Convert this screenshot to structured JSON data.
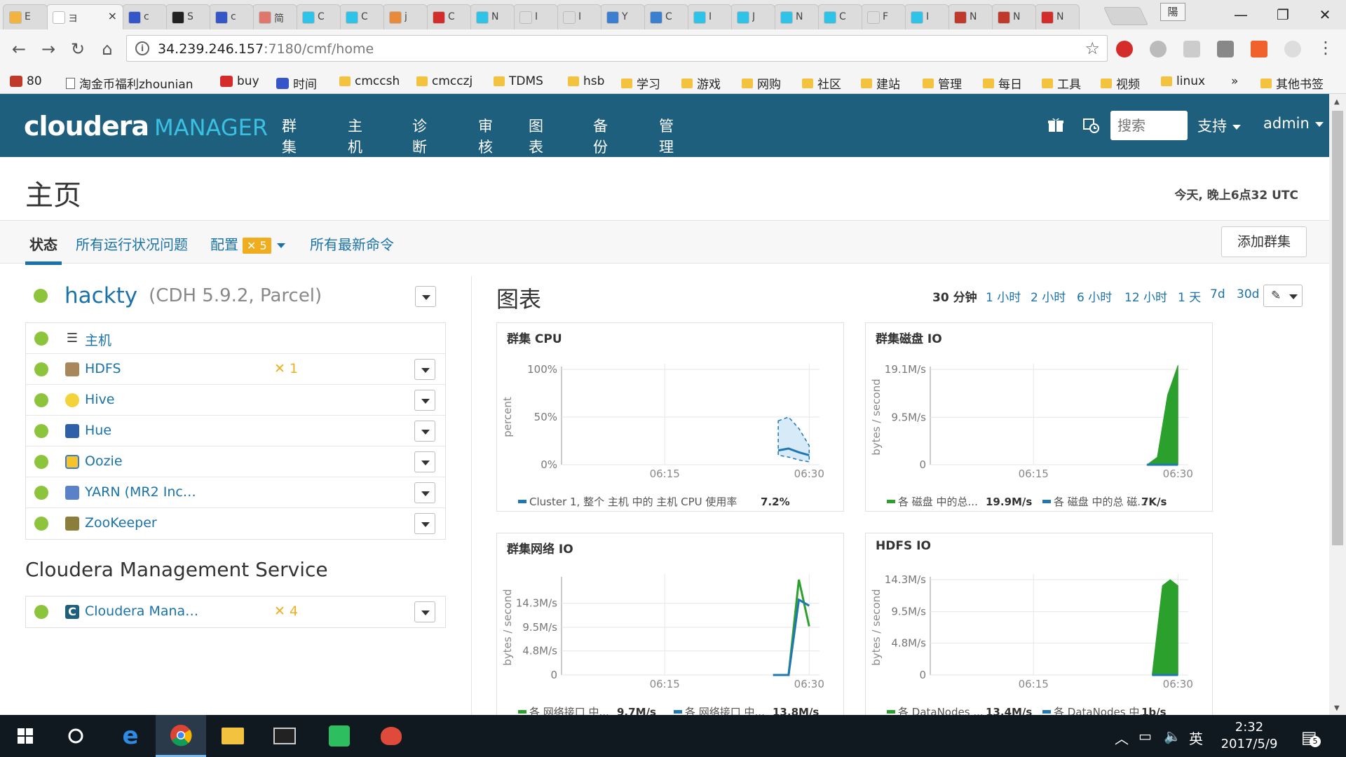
{
  "browser": {
    "tabs": [
      {
        "title": "E",
        "color": "#f3b33d"
      },
      {
        "title": "ヨ",
        "color": "#ffffff",
        "active": true
      },
      {
        "title": "c",
        "color": "#3556c9"
      },
      {
        "title": "S",
        "color": "#222222"
      },
      {
        "title": "c",
        "color": "#3556c9"
      },
      {
        "title": "简",
        "color": "#e0776b"
      },
      {
        "title": "C",
        "color": "#2ec3e8"
      },
      {
        "title": "C",
        "color": "#2ec3e8"
      },
      {
        "title": "j",
        "color": "#e98a3a"
      },
      {
        "title": "C",
        "color": "#d42b2b"
      },
      {
        "title": "N",
        "color": "#2ec3e8"
      },
      {
        "title": "I",
        "color": "#dddddd"
      },
      {
        "title": "I",
        "color": "#dddddd"
      },
      {
        "title": "Y",
        "color": "#3b7fd0"
      },
      {
        "title": "C",
        "color": "#3b7fd0"
      },
      {
        "title": "I",
        "color": "#2ec3e8"
      },
      {
        "title": "J",
        "color": "#2ec3e8"
      },
      {
        "title": "N",
        "color": "#2ec3e8"
      },
      {
        "title": "C",
        "color": "#2ec3e8"
      },
      {
        "title": "F",
        "color": "#dddddd"
      },
      {
        "title": "I",
        "color": "#2ec3e8"
      },
      {
        "title": "N",
        "color": "#c0392b"
      },
      {
        "title": "N",
        "color": "#c0392b"
      },
      {
        "title": "N",
        "color": "#d42b2b"
      }
    ],
    "active_tab_close": "×",
    "profile_glyph": "陽",
    "window_buttons": [
      "—",
      "❐",
      "✕"
    ],
    "url_host": "34.239.246.157",
    "url_path": ":7180/cmf/home",
    "bookmarks": [
      {
        "label": "80",
        "kind": "icon",
        "color": "#c0392b"
      },
      {
        "label": "淘金币福利zhounian",
        "kind": "page"
      },
      {
        "label": "buy",
        "kind": "icon",
        "color": "#d42b2b"
      },
      {
        "label": "时间",
        "kind": "icon",
        "color": "#3556c9"
      },
      {
        "label": "cmccsh",
        "kind": "folder"
      },
      {
        "label": "cmcczj",
        "kind": "folder"
      },
      {
        "label": "TDMS",
        "kind": "folder"
      },
      {
        "label": "hsb",
        "kind": "folder"
      },
      {
        "label": "学习",
        "kind": "folder"
      },
      {
        "label": "游戏",
        "kind": "folder"
      },
      {
        "label": "网购",
        "kind": "folder"
      },
      {
        "label": "社区",
        "kind": "folder"
      },
      {
        "label": "建站",
        "kind": "folder"
      },
      {
        "label": "管理",
        "kind": "folder"
      },
      {
        "label": "每日",
        "kind": "folder"
      },
      {
        "label": "工具",
        "kind": "folder"
      },
      {
        "label": "视频",
        "kind": "folder"
      },
      {
        "label": "linux",
        "kind": "folder"
      }
    ],
    "bookmarks_overflow": "»",
    "other_bookmarks": "其他书签"
  },
  "navbar": {
    "logo_main": "cloudera",
    "logo_sub": "MANAGER",
    "menus": [
      "群集",
      "主机",
      "诊断",
      "审核",
      "图表",
      "备份",
      "管理"
    ],
    "menus_with_caret": [
      true,
      true,
      true,
      false,
      true,
      true,
      true
    ],
    "search_placeholder": "搜索",
    "support": "支持",
    "user": "admin",
    "bg_color": "#1f5f7e"
  },
  "page": {
    "title": "主页",
    "timestamp": "今天, 晚上6点32 UTC",
    "subtabs": {
      "status": "状态",
      "issues": "所有运行状况问题",
      "config": "配置",
      "config_count": "5",
      "commands": "所有最新命令"
    },
    "add_cluster": "添加群集"
  },
  "cluster": {
    "name": "hackty",
    "version": "(CDH 5.9.2, Parcel)",
    "services": [
      {
        "name": "主机",
        "icon": "hosts-list-icon",
        "config": ""
      },
      {
        "name": "HDFS",
        "icon": "hdfs-icon",
        "config": "1"
      },
      {
        "name": "Hive",
        "icon": "hive-icon",
        "config": ""
      },
      {
        "name": "Hue",
        "icon": "hue-icon",
        "config": ""
      },
      {
        "name": "Oozie",
        "icon": "oozie-icon",
        "config": ""
      },
      {
        "name": "YARN (MR2 Inc…",
        "icon": "yarn-icon",
        "config": ""
      },
      {
        "name": "ZooKeeper",
        "icon": "zookeeper-icon",
        "config": ""
      }
    ]
  },
  "management": {
    "title": "Cloudera Management Service",
    "service": "Cloudera Mana…",
    "config": "4"
  },
  "charts_panel": {
    "title": "图表",
    "ranges": [
      "30 分钟",
      "1 小时",
      "2 小时",
      "6 小时",
      "12 小时",
      "1 天",
      "7d",
      "30d"
    ],
    "selected_range": "30 分钟"
  },
  "chart_data": [
    {
      "type": "area",
      "title": "群集 CPU",
      "ylabel": "percent",
      "ytick_labels": [
        "100%",
        "50%",
        "0%"
      ],
      "yticks": [
        100,
        50,
        0
      ],
      "ylim": [
        0,
        100
      ],
      "xtick_labels": [
        "06:15",
        "06:30"
      ],
      "series": [
        {
          "name": "Cluster 1, 整个 主机 中的 主机 CPU 使用率",
          "value_label": "7.2%",
          "color": "#1f77b4",
          "x": [
            0.84,
            0.88,
            0.92,
            0.96
          ],
          "y": [
            15,
            17,
            13,
            10
          ],
          "band_max": [
            46,
            50,
            38,
            20
          ],
          "band_min": [
            10,
            8,
            5,
            3
          ]
        }
      ]
    },
    {
      "type": "area",
      "title": "群集磁盘 IO",
      "ylabel": "bytes / second",
      "ytick_labels": [
        "19.1M/s",
        "9.5M/s",
        "0"
      ],
      "yticks": [
        19.1,
        9.5,
        0
      ],
      "ylim": [
        0,
        19.1
      ],
      "xtick_labels": [
        "06:15",
        "06:30"
      ],
      "series": [
        {
          "name": "各 磁盘 中的总...",
          "value_label": "19.9M/s",
          "color": "#2ca02c",
          "x": [
            0.84,
            0.88,
            0.92,
            0.96
          ],
          "y": [
            0,
            1.5,
            14,
            19.9
          ]
        },
        {
          "name": "各 磁盘 中的总 磁...",
          "value_label": "7K/s",
          "color": "#1f77b4",
          "x": [
            0.84,
            0.96
          ],
          "y": [
            0,
            0.007
          ]
        }
      ]
    },
    {
      "type": "line",
      "title": "群集网络 IO",
      "ylabel": "bytes / second",
      "ytick_labels": [
        "14.3M/s",
        "9.5M/s",
        "4.8M/s",
        "0"
      ],
      "yticks": [
        14.3,
        9.5,
        4.8,
        0
      ],
      "ylim": [
        0,
        19
      ],
      "xtick_labels": [
        "06:15",
        "06:30"
      ],
      "series": [
        {
          "name": "各 网络接口 中...",
          "value_label": "9.7M/s",
          "color": "#2ca02c",
          "x": [
            0.82,
            0.88,
            0.92,
            0.96
          ],
          "y": [
            0,
            0,
            19,
            9.7
          ]
        },
        {
          "name": "各 网络接口 中...",
          "value_label": "13.8M/s",
          "color": "#1f77b4",
          "x": [
            0.82,
            0.88,
            0.92,
            0.96
          ],
          "y": [
            0,
            0,
            15,
            13.8
          ]
        }
      ]
    },
    {
      "type": "area",
      "title": "HDFS IO",
      "ylabel": "bytes / second",
      "ytick_labels": [
        "14.3M/s",
        "9.5M/s",
        "4.8M/s",
        "0"
      ],
      "yticks": [
        14.3,
        9.5,
        4.8,
        0
      ],
      "ylim": [
        0,
        14.3
      ],
      "xtick_labels": [
        "06:15",
        "06:30"
      ],
      "series": [
        {
          "name": "各 DataNodes ...",
          "value_label": "13.4M/s",
          "color": "#2ca02c",
          "x": [
            0.86,
            0.9,
            0.93,
            0.96
          ],
          "y": [
            0,
            13.4,
            14.3,
            13.4
          ]
        },
        {
          "name": "各 DataNodes 中...",
          "value_label": "1b/s",
          "color": "#1f77b4",
          "x": [
            0.86,
            0.96
          ],
          "y": [
            0,
            0
          ]
        }
      ]
    }
  ],
  "taskbar": {
    "ime": "英",
    "time": "2:32",
    "date": "2017/5/9",
    "notifications": "5"
  }
}
